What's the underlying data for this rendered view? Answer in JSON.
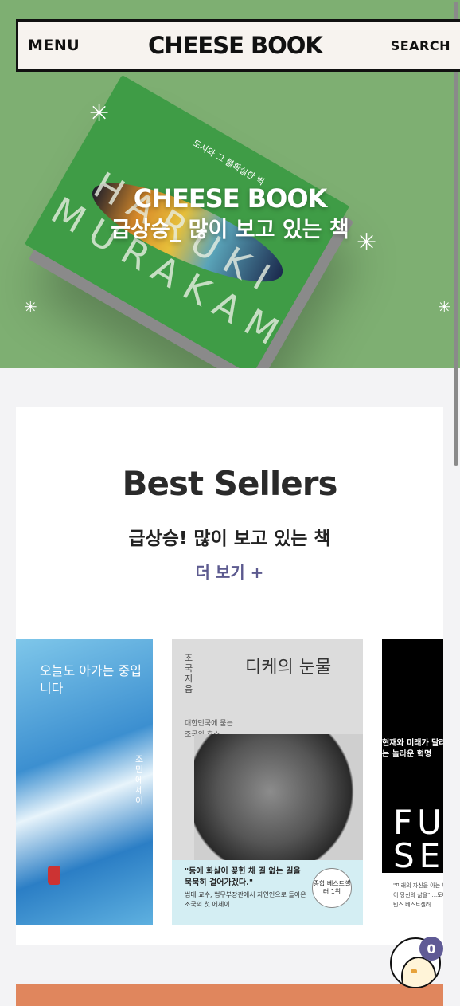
{
  "header": {
    "menu_label": "MENU",
    "logo": "CHEESE BOOK",
    "search_label": "SEARCH"
  },
  "hero": {
    "title": "CHEESE BOOK",
    "subtitle": "급상승_ 많이 보고 있는 책",
    "book": {
      "text_en": "HARUKI MURAKAMI",
      "text_ko": "도시와 그 불확실한 벽"
    }
  },
  "best_sellers": {
    "title": "Best Sellers",
    "subtitle": "급상승! 많이 보고 있는 책",
    "more_label": "더 보기 +",
    "books": [
      {
        "cover_text": "오늘도 아가는 중입니다",
        "author": "조민 에세이"
      },
      {
        "cover_title": "디케의 눈물",
        "author": "조국 지음",
        "tagline": "대한민국에 묻는 조국의 호소",
        "quote": "\"등에 화살이 꽂힌 채 길 없는 길을 묵묵히 걸어가겠다.\"",
        "desc": "법대 교수, 법무부장관에서 자연인으로 돌아온 조국의 첫 에세이",
        "seal": "종합 베스트셀러 1위"
      },
      {
        "cover_text": "현재와 미래가 달라지는 놀라운 혁명",
        "big": "FU SE",
        "small": "\"미래의 자신을 아는 이 책이 당신의 삶을\" ...토니 로빈스 베스트셀러"
      }
    ]
  },
  "cart": {
    "count": "0"
  }
}
